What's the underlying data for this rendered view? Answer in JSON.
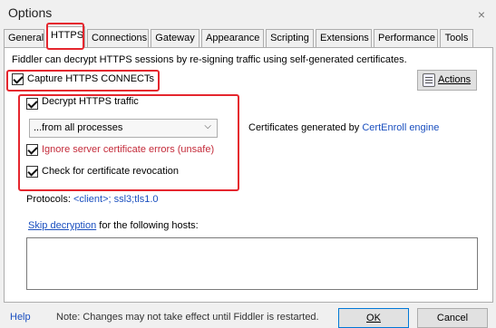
{
  "window": {
    "title": "Options",
    "close_glyph": "×"
  },
  "tabs": [
    {
      "label": "General"
    },
    {
      "label": "HTTPS"
    },
    {
      "label": "Connections"
    },
    {
      "label": "Gateway"
    },
    {
      "label": "Appearance"
    },
    {
      "label": "Scripting"
    },
    {
      "label": "Extensions"
    },
    {
      "label": "Performance"
    },
    {
      "label": "Tools"
    }
  ],
  "active_tab": "HTTPS",
  "https": {
    "intro": "Fiddler can decrypt HTTPS sessions by re-signing traffic using self-generated certificates.",
    "capture_label": "Capture HTTPS CONNECTs",
    "capture_checked": true,
    "actions_label": "Actions",
    "decrypt_label": "Decrypt HTTPS traffic",
    "decrypt_checked": true,
    "process_filter": "...from all processes",
    "ignore_errors_label": "Ignore server certificate errors (unsafe)",
    "ignore_errors_checked": true,
    "revocation_label": "Check for certificate revocation",
    "revocation_checked": true,
    "cert_prefix": "Certificates generated by ",
    "cert_engine": "CertEnroll engine",
    "protocols_label": "Protocols: ",
    "protocols_value": "<client>; ssl3;tls1.0",
    "skip_link": "Skip decryption",
    "skip_suffix": " for the following hosts:",
    "hosts_value": ""
  },
  "footer": {
    "help": "Help",
    "note": "Note: Changes may not take effect until Fiddler is restarted.",
    "ok": "OK",
    "cancel": "Cancel"
  },
  "colors": {
    "highlight": "#e5262e",
    "link": "#1a4fbf",
    "warning": "#c42b3a"
  }
}
